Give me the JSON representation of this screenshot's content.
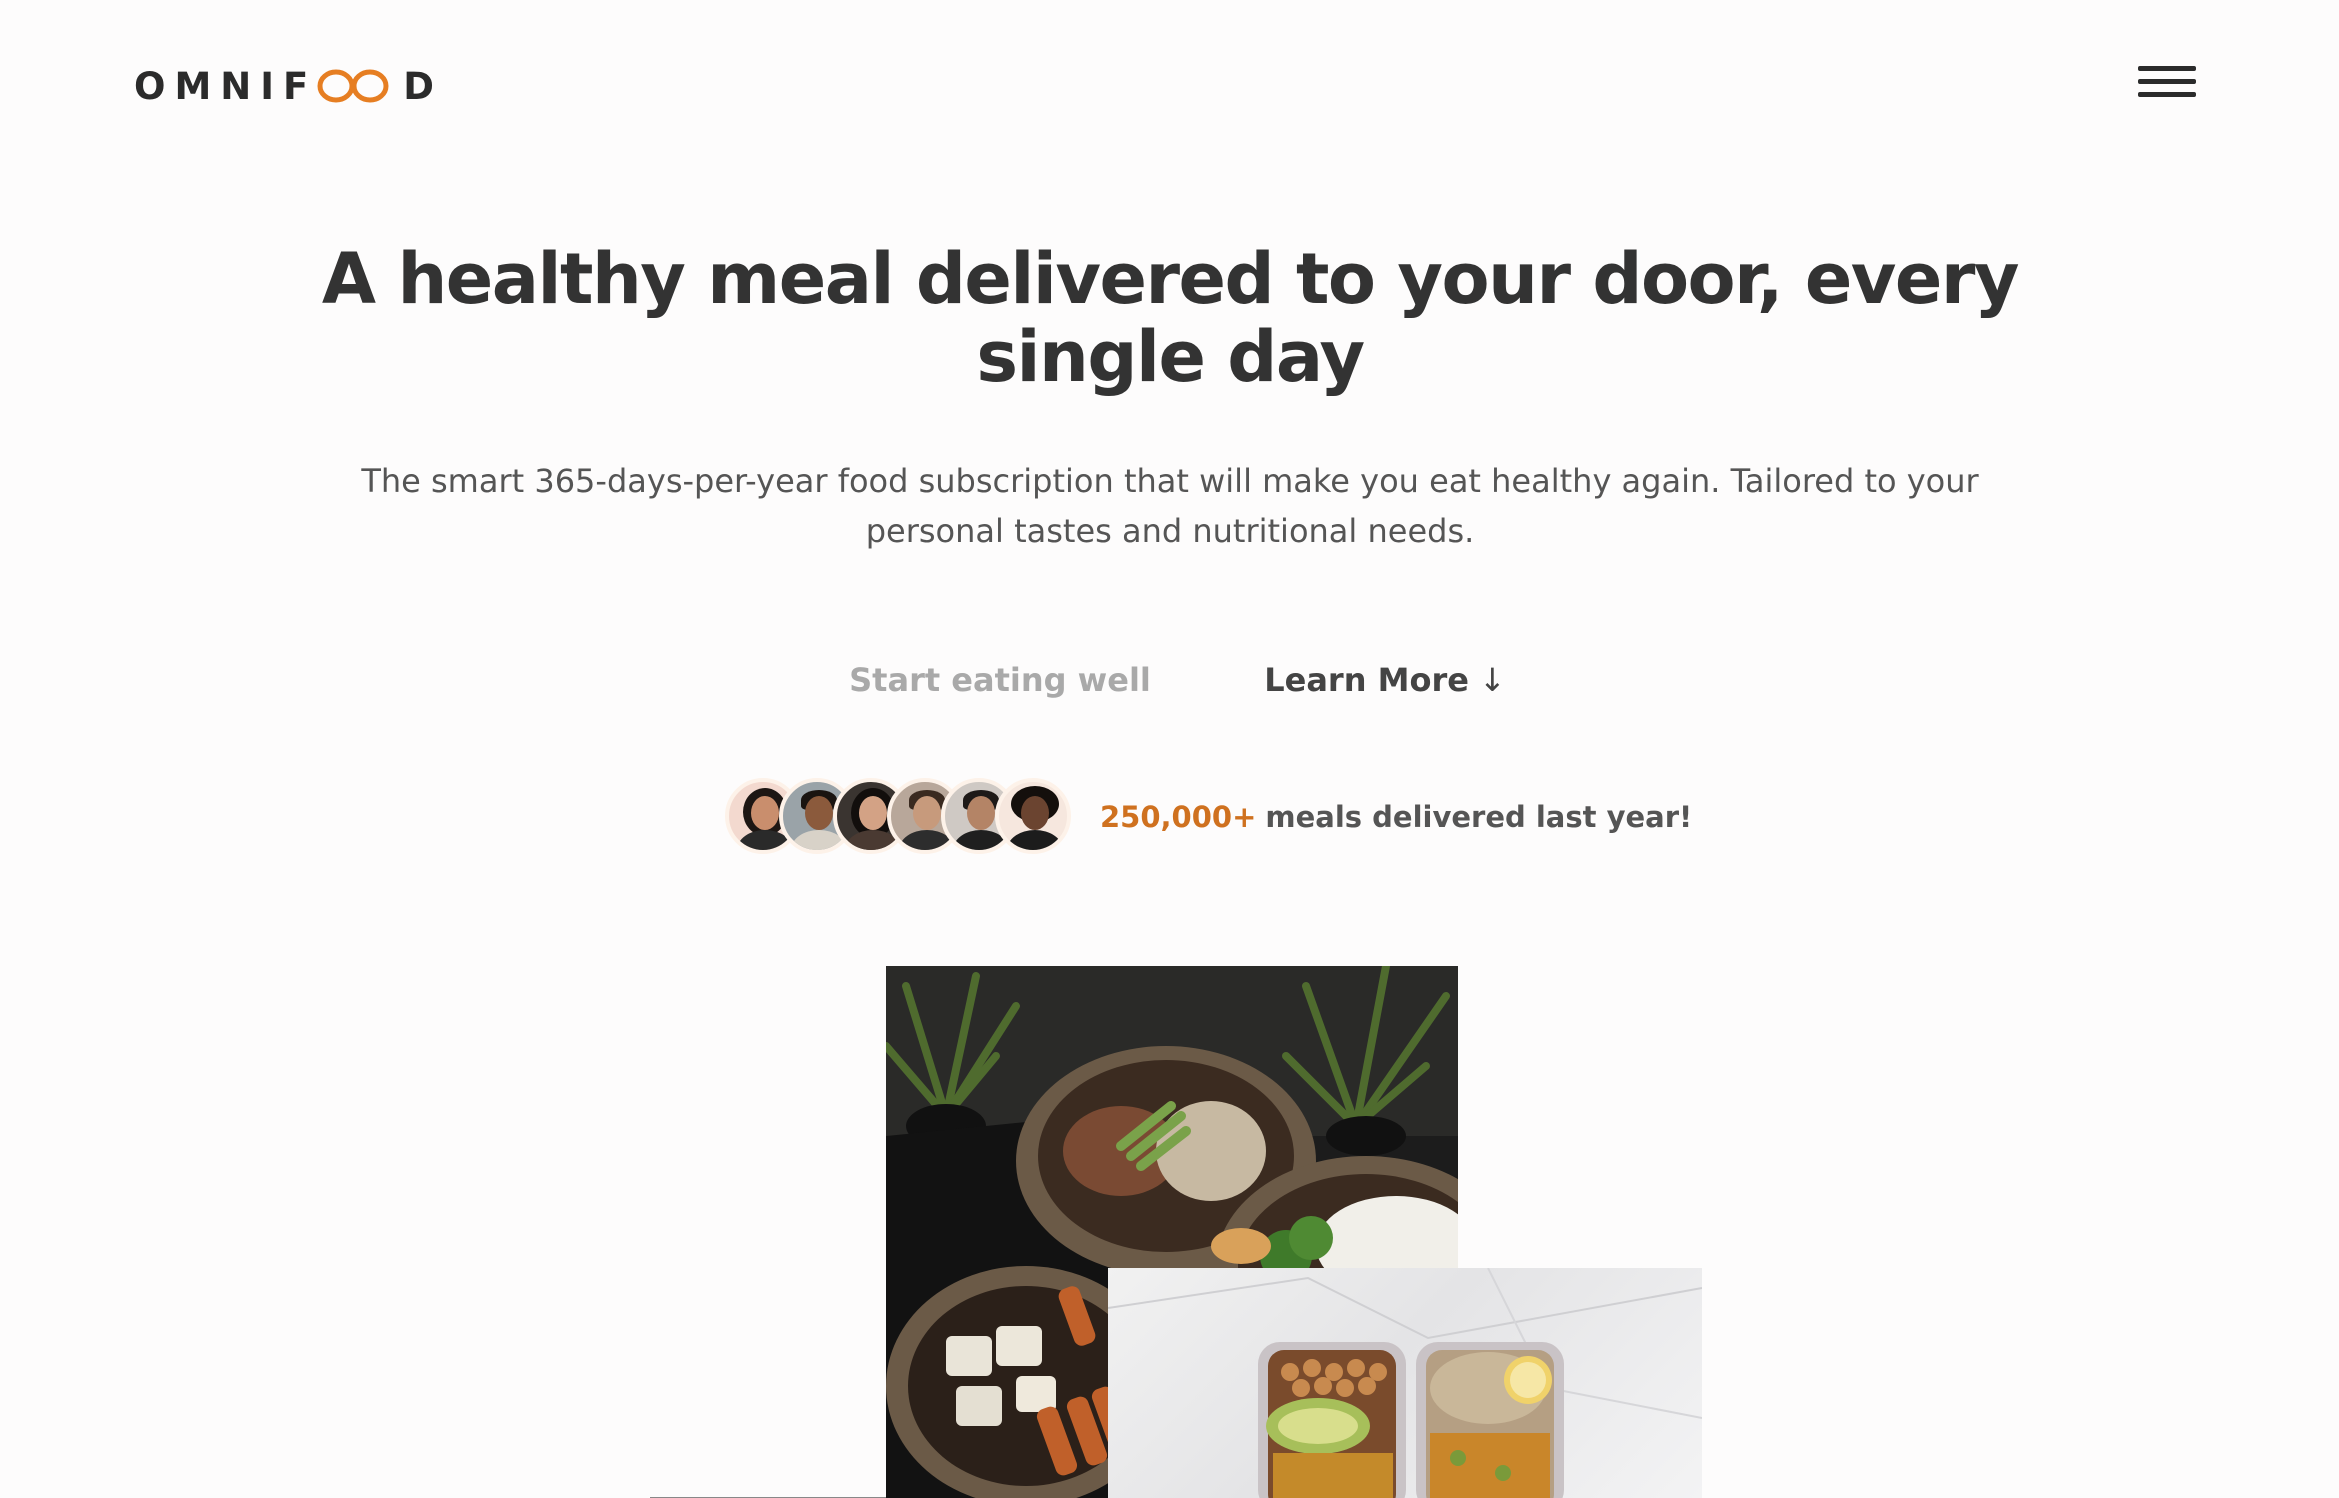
{
  "header": {
    "logo_prefix": "OMNIF",
    "logo_suffix": "D",
    "accent_color": "#e67e22",
    "menu_icon": "hamburger-menu-icon"
  },
  "hero": {
    "title": "A healthy meal delivered to your door, every single day",
    "description": "The smart 365-days-per-year food subscription that will make you eat healthy again. Tailored to your personal tastes and nutritional needs.",
    "primary_cta": "Start eating well",
    "secondary_cta": "Learn More",
    "secondary_cta_arrow": "↓"
  },
  "delivered_meals": {
    "count": "250,000+",
    "text": "meals delivered last year!",
    "count_color": "#cf711f"
  },
  "images": {
    "bowls_alt": "Food bowls with rice, meat and vegetables",
    "meal_prep_alt": "Meal prep containers with chickpeas, avocado and curry"
  }
}
